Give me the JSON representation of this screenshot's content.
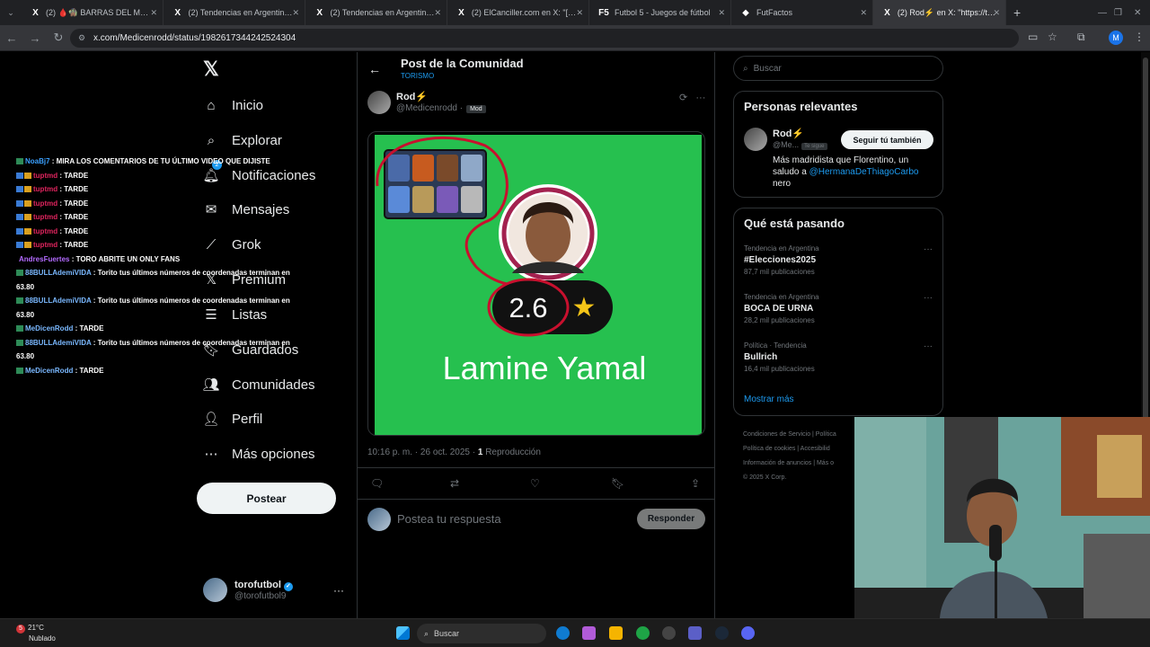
{
  "browser": {
    "tabs": [
      {
        "label": "(2) 🩸🧌 BARRAS DEL MUNDO",
        "fav": "X"
      },
      {
        "label": "(2) Tendencias en Argentina en",
        "fav": "X"
      },
      {
        "label": "(2) Tendencias en Argentina en",
        "fav": "X"
      },
      {
        "label": "(2) ElCanciller.com en X: \"[REDE",
        "fav": "X"
      },
      {
        "label": "Futbol 5 - Juegos de fútbol",
        "fav": "F5"
      },
      {
        "label": "FutFactos",
        "fav": "⬥"
      },
      {
        "label": "(2) Rod⚡ en X: \"https://t.co/kl",
        "fav": "X"
      }
    ],
    "url": "x.com/Medicenrodd/status/1982617344242524304",
    "profile_initial": "M"
  },
  "nav": {
    "logo": "𝕏",
    "items": [
      {
        "label": "Inicio",
        "icon": "⌂"
      },
      {
        "label": "Explorar",
        "icon": "⌕"
      },
      {
        "label": "Notificaciones",
        "icon": "🔔︎"
      },
      {
        "label": "Mensajes",
        "icon": "✉"
      },
      {
        "label": "Grok",
        "icon": "⟋"
      },
      {
        "label": "Premium",
        "icon": "𝕏"
      },
      {
        "label": "Listas",
        "icon": "☰"
      },
      {
        "label": "Guardados",
        "icon": "🔖︎"
      },
      {
        "label": "Comunidades",
        "icon": "👥︎"
      },
      {
        "label": "Perfil",
        "icon": "👤︎"
      },
      {
        "label": "Más opciones",
        "icon": "⋯"
      }
    ],
    "notif_badge": "2",
    "post_button": "Postear",
    "account": {
      "name": "torofutbol",
      "handle": "@torofutbol9",
      "more": "···"
    }
  },
  "post": {
    "header_title": "Post de la Comunidad",
    "header_sub": "TORISMO",
    "author_name": "Rod⚡",
    "author_handle": "@Medicenrodd ·",
    "mod_label": "Mod",
    "card": {
      "rating": "2.6",
      "player": "Lamine Yamal"
    },
    "time": "10:16 p. m. · 26 oct. 2025 ·",
    "views_count": "1",
    "views_label": "Reproducción",
    "reply_placeholder": "Postea tu respuesta",
    "reply_button": "Responder"
  },
  "sidebar": {
    "search_placeholder": "Buscar",
    "relevant_title": "Personas relevantes",
    "relevant": {
      "name": "Rod⚡",
      "handle": "@Me...",
      "follows_you": "Te sigue",
      "follow_button": "Seguir tú también",
      "bio_1": "Más madridista que Florentino, un saludo a ",
      "bio_mention": "@HermanaDeThiagoCarbo",
      "bio_2": "nero"
    },
    "trends_title": "Qué está pasando",
    "trends": [
      {
        "meta": "Tendencia en Argentina",
        "name": "#Elecciones2025",
        "count": "87,7 mil publicaciones"
      },
      {
        "meta": "Tendencia en Argentina",
        "name": "BOCA DE URNA",
        "count": "28,2 mil publicaciones"
      },
      {
        "meta": "Política · Tendencia",
        "name": "Bullrich",
        "count": "16,4 mil publicaciones"
      }
    ],
    "show_more": "Mostrar más",
    "footer": {
      "l1": "Condiciones de Servicio  |  Política",
      "l2": "Política de cookies  |  Accesibilid",
      "l3": "Información de anuncios  |  Más o",
      "l4": "© 2025 X Corp."
    }
  },
  "chat": [
    {
      "user": "NoaBj7",
      "msg": " : MIRA LOS COMENTARIOS DE TU ÚLTIMO VIDEO QUE DIJISTE",
      "color": "#3aa0ff",
      "type": "a"
    },
    {
      "user": "tuptmd",
      "msg": " : TARDE",
      "color": "#e0245e",
      "type": "b"
    },
    {
      "user": "tuptmd",
      "msg": " : TARDE",
      "color": "#e0245e",
      "type": "b"
    },
    {
      "user": "tuptmd",
      "msg": " : TARDE",
      "color": "#e0245e",
      "type": "b"
    },
    {
      "user": "tuptmd",
      "msg": " : TARDE",
      "color": "#e0245e",
      "type": "b"
    },
    {
      "user": "tuptmd",
      "msg": " : TARDE",
      "color": "#e0245e",
      "type": "b"
    },
    {
      "user": "tuptmd",
      "msg": " : TARDE",
      "color": "#e0245e",
      "type": "b"
    },
    {
      "user": "AndresFuertes",
      "msg": " : TORO ABRITE UN ONLY FANS",
      "color": "#b36bff",
      "type": "c"
    },
    {
      "user": "88BULLAdemiVIDA",
      "msg": " : Torito tus últimos números de coordenadas terminan en",
      "color": "#7ab8ff",
      "type": "a"
    },
    {
      "user": "",
      "msg": "63.80",
      "color": "#fff",
      "type": "d"
    },
    {
      "user": "88BULLAdemiVIDA",
      "msg": " : Torito tus últimos números de coordenadas terminan en",
      "color": "#7ab8ff",
      "type": "a"
    },
    {
      "user": "",
      "msg": "63.80",
      "color": "#fff",
      "type": "d"
    },
    {
      "user": "MeDicenRodd",
      "msg": " : TARDE",
      "color": "#7ab8ff",
      "type": "a"
    },
    {
      "user": "88BULLAdemiVIDA",
      "msg": " : Torito tus últimos números de coordenadas terminan en",
      "color": "#7ab8ff",
      "type": "a"
    },
    {
      "user": "",
      "msg": "63.80",
      "color": "#fff",
      "type": "d"
    },
    {
      "user": "MeDicenRodd",
      "msg": " : TARDE",
      "color": "#7ab8ff",
      "type": "a"
    }
  ],
  "taskbar": {
    "weather_badge": "5",
    "temp": "21°C",
    "condition": "Nublado",
    "search": "Buscar"
  }
}
